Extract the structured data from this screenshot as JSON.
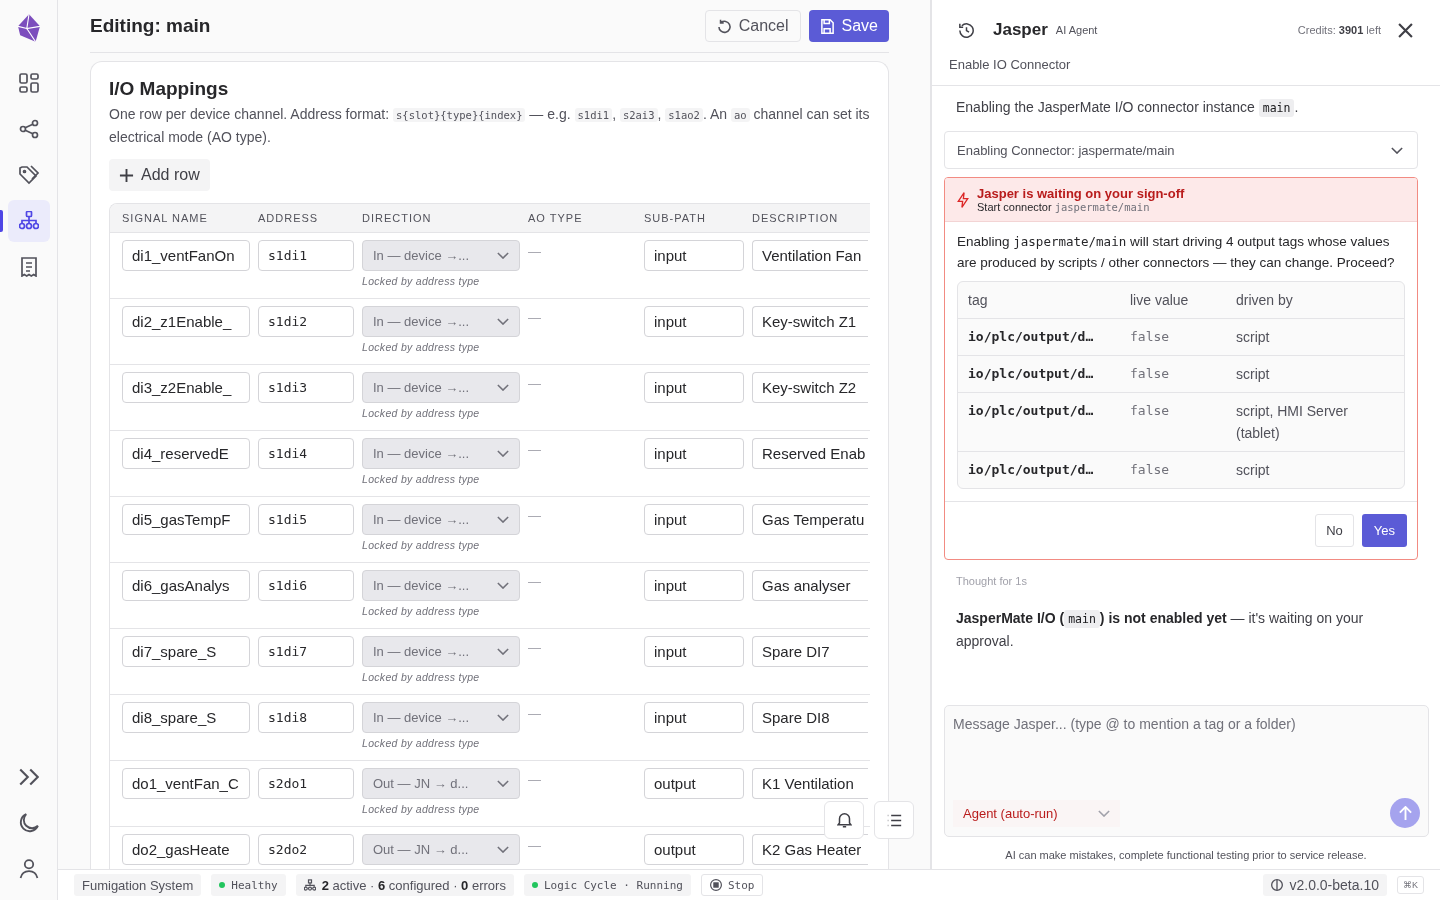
{
  "nav": [
    {
      "selected": false
    },
    {
      "selected": false
    },
    {
      "selected": false
    },
    {
      "selected": true
    },
    {
      "selected": false
    }
  ],
  "header": {
    "title": "Editing: main",
    "cancel": "Cancel",
    "save": "Save"
  },
  "mappings": {
    "title": "I/O Mappings",
    "description": [
      {
        "kind": "plain",
        "text": "One row per device channel. Address format: "
      },
      {
        "kind": "code",
        "text": "s{slot}{type}{index}"
      },
      {
        "kind": "plain",
        "text": " — e.g. "
      },
      {
        "kind": "code",
        "text": "s1di1"
      },
      {
        "kind": "plain",
        "text": ", "
      },
      {
        "kind": "code",
        "text": "s2ai3"
      },
      {
        "kind": "plain",
        "text": ", "
      },
      {
        "kind": "code",
        "text": "s1ao2"
      },
      {
        "kind": "plain",
        "text": ". An "
      },
      {
        "kind": "code",
        "text": "ao"
      },
      {
        "kind": "plain",
        "text": " channel can set its electrical mode (AO type)."
      }
    ],
    "add_row": "Add row",
    "columns": [
      "SIGNAL NAME",
      "ADDRESS",
      "DIRECTION",
      "AO TYPE",
      "SUB-PATH",
      "DESCRIPTION"
    ],
    "rows": [
      {
        "name": "di1_ventFanOn",
        "address": "s1di1",
        "direction": "In — device →...",
        "locked": true,
        "ao_type": "—",
        "sub_path": "input",
        "description": "Ventilation Fan",
        "note": "Locked by address type"
      },
      {
        "name": "di2_z1Enable_",
        "address": "s1di2",
        "direction": "In — device →...",
        "locked": true,
        "ao_type": "—",
        "sub_path": "input",
        "description": "Key-switch Z1",
        "note": "Locked by address type"
      },
      {
        "name": "di3_z2Enable_",
        "address": "s1di3",
        "direction": "In — device →...",
        "locked": true,
        "ao_type": "—",
        "sub_path": "input",
        "description": "Key-switch Z2",
        "note": "Locked by address type"
      },
      {
        "name": "di4_reservedE",
        "address": "s1di4",
        "direction": "In — device →...",
        "locked": true,
        "ao_type": "—",
        "sub_path": "input",
        "description": "Reserved Enab",
        "note": "Locked by address type"
      },
      {
        "name": "di5_gasTempF",
        "address": "s1di5",
        "direction": "In — device →...",
        "locked": true,
        "ao_type": "—",
        "sub_path": "input",
        "description": "Gas Temperatu",
        "note": "Locked by address type"
      },
      {
        "name": "di6_gasAnalys",
        "address": "s1di6",
        "direction": "In — device →...",
        "locked": true,
        "ao_type": "—",
        "sub_path": "input",
        "description": "Gas analyser",
        "note": "Locked by address type"
      },
      {
        "name": "di7_spare_S",
        "address": "s1di7",
        "direction": "In — device →...",
        "locked": true,
        "ao_type": "—",
        "sub_path": "input",
        "description": "Spare DI7",
        "note": "Locked by address type"
      },
      {
        "name": "di8_spare_S",
        "address": "s1di8",
        "direction": "In — device →...",
        "locked": true,
        "ao_type": "—",
        "sub_path": "input",
        "description": "Spare DI8",
        "note": "Locked by address type"
      },
      {
        "name": "do1_ventFan_C",
        "address": "s2do1",
        "direction": "Out — JN → d...",
        "locked": true,
        "ao_type": "—",
        "sub_path": "output",
        "description": "K1 Ventilation",
        "note": "Locked by address type"
      },
      {
        "name": "do2_gasHeate",
        "address": "s2do2",
        "direction": "Out — JN → d...",
        "locked": true,
        "ao_type": "—",
        "sub_path": "output",
        "description": "K2 Gas Heater"
      }
    ]
  },
  "assistant": {
    "name": "Jasper",
    "role": "AI Agent",
    "credits": "Credits: **3901** left",
    "subtitle": "Enable IO Connector",
    "intro": [
      {
        "kind": "plain",
        "text": "Enabling the JasperMate I/O connector instance "
      },
      {
        "kind": "code",
        "text": "main"
      },
      {
        "kind": "plain",
        "text": "."
      }
    ],
    "step": {
      "label": "Enabling Connector: jaspermate/main",
      "expanded": false
    },
    "approval": {
      "title": "Jasper is waiting on your sign-off",
      "action": "Start connector",
      "target": "jaspermate/main",
      "body": [
        {
          "kind": "plain",
          "text": "Enabling "
        },
        {
          "kind": "code",
          "text": "jaspermate/main"
        },
        {
          "kind": "plain",
          "text": " will start driving 4 output tags whose values are produced by scripts / other connectors — they can change. Proceed?"
        }
      ],
      "columns": [
        "tag",
        "live value",
        "driven by"
      ],
      "rows": [
        {
          "tag": "io/plc/output/d…",
          "value": "false",
          "driven_by": "script"
        },
        {
          "tag": "io/plc/output/d…",
          "value": "false",
          "driven_by": "script"
        },
        {
          "tag": "io/plc/output/d…",
          "value": "false",
          "driven_by": "script, HMI Server (tablet)"
        },
        {
          "tag": "io/plc/output/d…",
          "value": "false",
          "driven_by": "script"
        }
      ],
      "no": "No",
      "yes": "Yes"
    },
    "thought": "Thought for 1s",
    "reply": [
      {
        "kind": "bold",
        "text": "JasperMate I/O ("
      },
      {
        "kind": "code",
        "text": "main"
      },
      {
        "kind": "bold",
        "text": ") is not enabled yet"
      },
      {
        "kind": "plain",
        "text": " — it's waiting on your approval."
      }
    ],
    "composer": {
      "placeholder": "Message Jasper... (type @ to mention a tag or a folder)",
      "mode": "Agent (auto-run)"
    },
    "disclaimer": "AI can make mistakes, complete functional testing prior to service release."
  },
  "status": {
    "project": "Fumigation System",
    "health": "Healthy",
    "connectors": "**2** active · **6** configured · **0** errors",
    "cycle": "Logic Cycle · Running",
    "stop": "Stop",
    "version": "v2.0.0-beta.10",
    "shortcut": "⌘K"
  }
}
